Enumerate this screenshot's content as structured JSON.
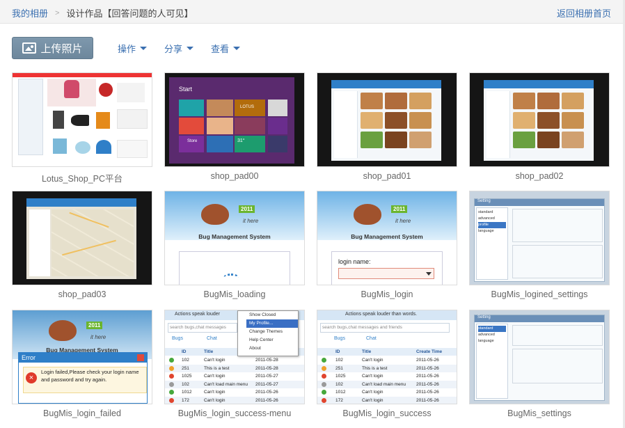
{
  "breadcrumb": {
    "root": "我的相册",
    "separator": ">",
    "current": "设计作品【回答问题的人可见】"
  },
  "back_link": "返回相册首页",
  "toolbar": {
    "upload": "上传照片",
    "menus": [
      "操作",
      "分享",
      "查看"
    ]
  },
  "photos": [
    {
      "caption": "Lotus_Shop_PC平台"
    },
    {
      "caption": "shop_pad00",
      "screen": {
        "start": "Start",
        "store": "Store",
        "temp": "31°",
        "brand": "LOTUS"
      }
    },
    {
      "caption": "shop_pad01"
    },
    {
      "caption": "shop_pad02"
    },
    {
      "caption": "shop_pad03"
    },
    {
      "caption": "BugMis_loading",
      "screen": {
        "year": "2011",
        "tag": "it here",
        "title": "Bug Management System"
      }
    },
    {
      "caption": "BugMis_login",
      "screen": {
        "year": "2011",
        "tag": "it here",
        "title": "Bug Management System",
        "login_label": "login name:"
      }
    },
    {
      "caption": "BugMis_logined_settings",
      "screen": {
        "title": "Setting",
        "items": [
          "standard",
          "advanced",
          "profile",
          "language"
        ]
      }
    },
    {
      "caption": "BugMis_login_failed",
      "screen": {
        "year": "2011",
        "tag": "it here",
        "title": "Bug Management System",
        "error_title": "Error",
        "error_msg": "Login failed,Please check your  login name and password and  try again."
      }
    },
    {
      "caption": "BugMis_login_success-menu",
      "screen": {
        "banner": "Actions speak louder",
        "search": "search bugs,chat messages",
        "tabs": [
          "Bugs",
          "Chat"
        ],
        "menu": [
          "Show Closed",
          "My Profile...",
          "Change Themes",
          "Help Center",
          "About"
        ],
        "headers": [
          "ID",
          "Title"
        ],
        "rows": [
          [
            "102",
            "Can't login",
            "2011-05-28"
          ],
          [
            "251",
            "This is a test",
            "2011-05-28"
          ],
          [
            "1025",
            "Can't login",
            "2011-05-27"
          ],
          [
            "102",
            "Can't load main menu",
            "2011-05-27"
          ],
          [
            "1012",
            "Can't login",
            "2011-05-26"
          ],
          [
            "172",
            "Can't login",
            "2011-05-26"
          ]
        ]
      }
    },
    {
      "caption": "BugMis_login_success",
      "screen": {
        "banner": "Actions speak louder than words.",
        "search": "search bugs,chat messages and friends",
        "tabs": [
          "Bugs",
          "Chat"
        ],
        "headers": [
          "ID",
          "Title",
          "Create Time"
        ],
        "rows": [
          [
            "102",
            "Can't login",
            "2011-05-26"
          ],
          [
            "251",
            "This is a test",
            "2011-05-26"
          ],
          [
            "1025",
            "Can't login",
            "2011-05-26"
          ],
          [
            "102",
            "Can't load main menu",
            "2011-05-26"
          ],
          [
            "1012",
            "Can't login",
            "2011-05-26"
          ],
          [
            "172",
            "Can't login",
            "2011-05-26"
          ]
        ]
      }
    },
    {
      "caption": "BugMis_settings",
      "screen": {
        "title": "Setting",
        "items": [
          "standard",
          "advanced",
          "language"
        ]
      }
    }
  ],
  "colors": {
    "link": "#3a6fb0",
    "upload_bg": "#7690a5",
    "row_dots": [
      "#46a83c",
      "#f0a02a",
      "#e0452e",
      "#9a9a9a",
      "#46a83c",
      "#e0452e"
    ]
  }
}
